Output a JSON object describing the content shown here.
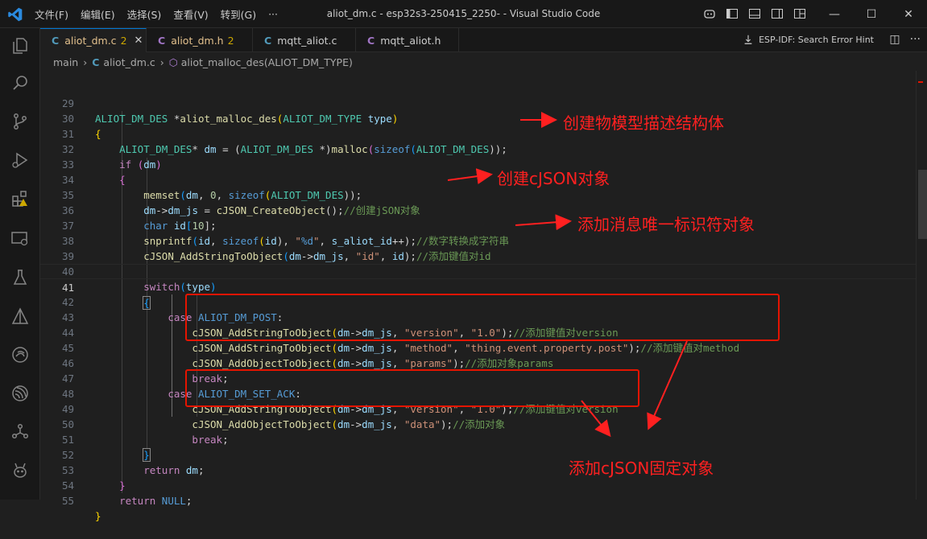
{
  "titlebar": {
    "menu": [
      "文件(F)",
      "编辑(E)",
      "选择(S)",
      "查看(V)",
      "转到(G)",
      "···"
    ],
    "title": "aliot_dm.c - esp32s3-250415_2250- - Visual Studio Code",
    "window_controls": [
      "minimize-icon",
      "maximize-icon",
      "close-icon"
    ]
  },
  "tabs": [
    {
      "icon": "C",
      "name": "aliot_dm.c",
      "badge": "2"
    },
    {
      "icon": "C",
      "name": "aliot_dm.h",
      "badge": "2"
    },
    {
      "icon": "C",
      "name": "mqtt_aliot.c",
      "badge": ""
    },
    {
      "icon": "C",
      "name": "mqtt_aliot.h",
      "badge": ""
    }
  ],
  "espidf_label": "ESP-IDF: Search Error Hint",
  "breadcrumb": [
    "main",
    "aliot_dm.c",
    "aliot_malloc_des(ALIOT_DM_TYPE)"
  ],
  "line_numbers": [
    "29",
    "30",
    "31",
    "32",
    "33",
    "34",
    "35",
    "36",
    "37",
    "38",
    "39",
    "40",
    "41",
    "42",
    "43",
    "44",
    "45",
    "46",
    "47",
    "48",
    "49",
    "50",
    "51",
    "52",
    "53",
    "54",
    "55"
  ],
  "code": {
    "l29": [
      "ALIOT_DM_DES",
      " *",
      "aliot_malloc_des",
      "(",
      "ALIOT_DM_TYPE",
      " ",
      "type",
      ")"
    ],
    "l31": [
      "ALIOT_DM_DES",
      "* ",
      "dm",
      " = (",
      "ALIOT_DM_DES",
      " *)",
      "malloc",
      "(",
      "sizeof",
      "(",
      "ALIOT_DM_DES",
      "));"
    ],
    "l32": [
      "if",
      " (",
      "dm",
      ")"
    ],
    "l34": [
      "memset",
      "(",
      "dm",
      ", ",
      "0",
      ", ",
      "sizeof",
      "(",
      "ALIOT_DM_DES",
      "));"
    ],
    "l35": [
      "dm",
      "->",
      "dm_js",
      " = ",
      "cJSON_CreateObject",
      "();",
      "//创建jSON对象"
    ],
    "l36": [
      "char",
      " ",
      "id",
      "[",
      "10",
      "];"
    ],
    "l37": [
      "snprintf",
      "(",
      "id",
      ", ",
      "sizeof",
      "(",
      "id",
      "), ",
      "\"",
      "%d",
      "\"",
      ", ",
      "s_aliot_id",
      "++);",
      "//数字转换成字符串"
    ],
    "l38": [
      "cJSON_AddStringToObject",
      "(",
      "dm",
      "->",
      "dm_js",
      ", ",
      "\"id\"",
      ", ",
      "id",
      ");",
      "//添加键值对id"
    ],
    "l40": [
      "switch",
      "(",
      "type",
      ")"
    ],
    "l42": [
      "case",
      " ",
      "ALIOT_DM_POST",
      ":"
    ],
    "l43": [
      "cJSON_AddStringToObject",
      "(",
      "dm",
      "->",
      "dm_js",
      ", ",
      "\"version\"",
      ", ",
      "\"1.0\"",
      ");",
      "//添加键值对version"
    ],
    "l44": [
      "cJSON_AddStringToObject",
      "(",
      "dm",
      "->",
      "dm_js",
      ", ",
      "\"method\"",
      ", ",
      "\"thing.event.property.post\"",
      ");",
      "//添加键值对method"
    ],
    "l45": [
      "cJSON_AddObjectToObject",
      "(",
      "dm",
      "->",
      "dm_js",
      ", ",
      "\"params\"",
      ");",
      "//添加对象params"
    ],
    "l46": [
      "break",
      ";"
    ],
    "l47": [
      "case",
      " ",
      "ALIOT_DM_SET_ACK",
      ":"
    ],
    "l48": [
      "cJSON_AddStringToObject",
      "(",
      "dm",
      "->",
      "dm_js",
      ", ",
      "\"version\"",
      ", ",
      "\"1.0\"",
      ");",
      "//添加键值对version"
    ],
    "l49": [
      "cJSON_AddObjectToObject",
      "(",
      "dm",
      "->",
      "dm_js",
      ", ",
      "\"data\"",
      ");",
      "//添加对象"
    ],
    "l50": [
      "break",
      ";"
    ],
    "l52": [
      "return",
      " ",
      "dm",
      ";"
    ],
    "l54": [
      "return",
      " ",
      "NULL",
      ";"
    ]
  },
  "annotations": {
    "a1": "创建物模型描述结构体",
    "a2": "创建cJSON对象",
    "a3": "添加消息唯一标识符对象",
    "a4": "添加cJSON固定对象"
  },
  "colors": {
    "annotation": "#ff2020",
    "accent": "#0078d4"
  }
}
